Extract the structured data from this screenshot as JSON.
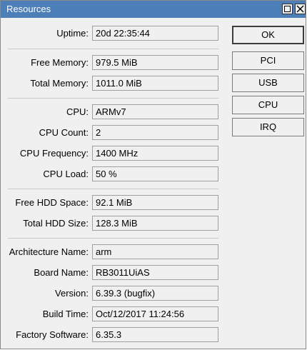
{
  "window": {
    "title": "Resources"
  },
  "fields": {
    "uptime": {
      "label": "Uptime:",
      "value": "20d 22:35:44"
    },
    "free_memory": {
      "label": "Free Memory:",
      "value": "979.5 MiB"
    },
    "total_memory": {
      "label": "Total Memory:",
      "value": "1011.0 MiB"
    },
    "cpu": {
      "label": "CPU:",
      "value": "ARMv7"
    },
    "cpu_count": {
      "label": "CPU Count:",
      "value": "2"
    },
    "cpu_frequency": {
      "label": "CPU Frequency:",
      "value": "1400 MHz"
    },
    "cpu_load": {
      "label": "CPU Load:",
      "value": "50 %"
    },
    "free_hdd_space": {
      "label": "Free HDD Space:",
      "value": "92.1 MiB"
    },
    "total_hdd_size": {
      "label": "Total HDD Size:",
      "value": "128.3 MiB"
    },
    "architecture_name": {
      "label": "Architecture Name:",
      "value": "arm"
    },
    "board_name": {
      "label": "Board Name:",
      "value": "RB3011UiAS"
    },
    "version": {
      "label": "Version:",
      "value": "6.39.3 (bugfix)"
    },
    "build_time": {
      "label": "Build Time:",
      "value": "Oct/12/2017 11:24:56"
    },
    "factory_software": {
      "label": "Factory Software:",
      "value": "6.35.3"
    }
  },
  "buttons": {
    "ok": "OK",
    "pci": "PCI",
    "usb": "USB",
    "cpu": "CPU",
    "irq": "IRQ"
  },
  "icons": {
    "maximize": "maximize-icon",
    "close": "close-icon"
  },
  "colors": {
    "titlebar": "#4c7fb7",
    "window_bg": "#f0f0f0"
  }
}
